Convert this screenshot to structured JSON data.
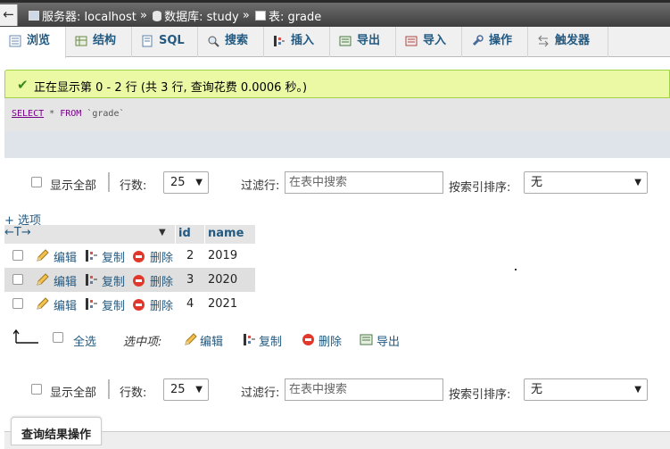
{
  "breadcrumb": {
    "back": "←",
    "server": "服务器: localhost",
    "sep1": "»",
    "database": "数据库: study",
    "sep2": "»",
    "table": "表: grade"
  },
  "tabs": [
    {
      "label": "浏览",
      "icon": "browse-icon"
    },
    {
      "label": "结构",
      "icon": "structure-icon"
    },
    {
      "label": "SQL",
      "icon": "sql-icon"
    },
    {
      "label": "搜索",
      "icon": "search-icon"
    },
    {
      "label": "插入",
      "icon": "insert-icon"
    },
    {
      "label": "导出",
      "icon": "export-icon"
    },
    {
      "label": "导入",
      "icon": "import-icon"
    },
    {
      "label": "操作",
      "icon": "wrench-icon"
    },
    {
      "label": "触发器",
      "icon": "trigger-icon"
    }
  ],
  "message": "正在显示第 0 - 2 行 (共 3 行, 查询花费 0.0006 秒。)",
  "sql": {
    "select": "SELECT",
    "star": "*",
    "from": "FROM",
    "table": "`grade`"
  },
  "nav": {
    "show_all": "显示全部",
    "rows_label": "行数:",
    "rows_value": "25",
    "filter_label": "过滤行:",
    "filter_placeholder": "在表中搜索",
    "sort_label": "按索引排序:",
    "sort_value": "无"
  },
  "options_link": "+ 选项",
  "table": {
    "header_arrows": "←T→",
    "columns": [
      "id",
      "name"
    ],
    "actions": {
      "edit": "编辑",
      "copy": "复制",
      "delete": "删除"
    },
    "rows": [
      {
        "id": "2",
        "name": "2019"
      },
      {
        "id": "3",
        "name": "2020"
      },
      {
        "id": "4",
        "name": "2021"
      }
    ]
  },
  "bulk": {
    "select_all": "全选",
    "selected": "选中项:",
    "edit": "编辑",
    "copy": "复制",
    "delete": "删除",
    "export": "导出"
  },
  "result_ops": "查询结果操作",
  "colors": {
    "link": "#235a81",
    "success_bg": "#ebf8a4",
    "success_border": "#a2d246",
    "delete": "#e0392b"
  }
}
